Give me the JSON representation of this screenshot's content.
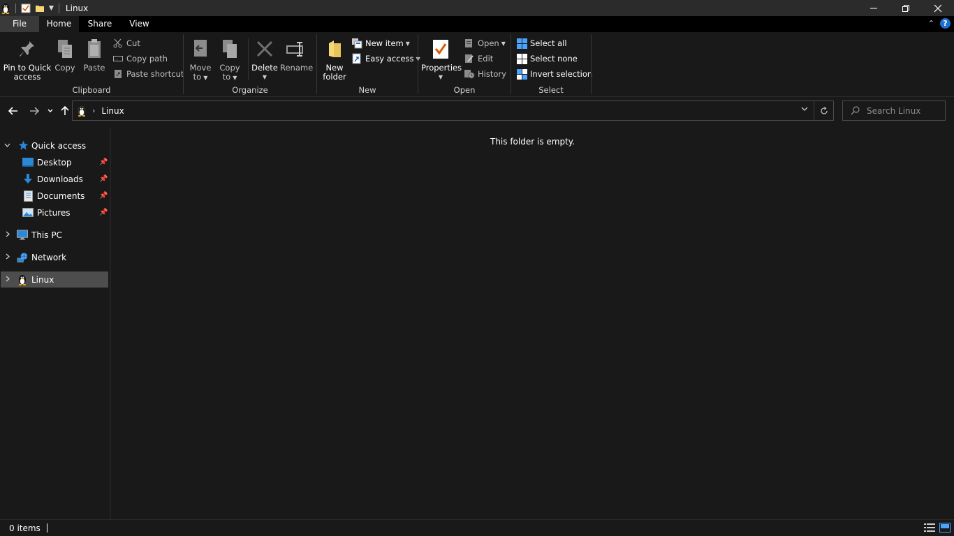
{
  "window": {
    "title": "Linux"
  },
  "tabs": [
    {
      "label": "File"
    },
    {
      "label": "Home"
    },
    {
      "label": "Share"
    },
    {
      "label": "View"
    }
  ],
  "ribbon": {
    "clipboard": {
      "pin": "Pin to Quick access",
      "pin_line1": "Pin to Quick",
      "pin_line2": "access",
      "copy": "Copy",
      "paste": "Paste",
      "cut": "Cut",
      "copy_path": "Copy path",
      "paste_shortcut": "Paste shortcut",
      "label": "Clipboard"
    },
    "organize": {
      "move_line1": "Move",
      "move_line2": "to",
      "copy_line1": "Copy",
      "copy_line2": "to",
      "delete": "Delete",
      "rename": "Rename",
      "label": "Organize"
    },
    "new": {
      "folder_line1": "New",
      "folder_line2": "folder",
      "new_item": "New item",
      "easy_access": "Easy access",
      "label": "New"
    },
    "open": {
      "properties": "Properties",
      "open": "Open",
      "edit": "Edit",
      "history": "History",
      "label": "Open"
    },
    "select": {
      "select_all": "Select all",
      "select_none": "Select none",
      "invert": "Invert selection",
      "label": "Select"
    }
  },
  "address": {
    "crumb": "Linux",
    "search_placeholder": "Search Linux"
  },
  "nav": {
    "quick_access": "Quick access",
    "pinned": [
      {
        "label": "Desktop"
      },
      {
        "label": "Downloads"
      },
      {
        "label": "Documents"
      },
      {
        "label": "Pictures"
      }
    ],
    "this_pc": "This PC",
    "network": "Network",
    "linux": "Linux"
  },
  "content": {
    "empty_message": "This folder is empty."
  },
  "status": {
    "item_count": "0 items"
  },
  "colors": {
    "background": "#191919",
    "titlebar": "#2b2b2b",
    "selected_nav": "#4d4d4d",
    "accent_blue": "#0078d7",
    "help_blue": "#1e6fd0"
  }
}
